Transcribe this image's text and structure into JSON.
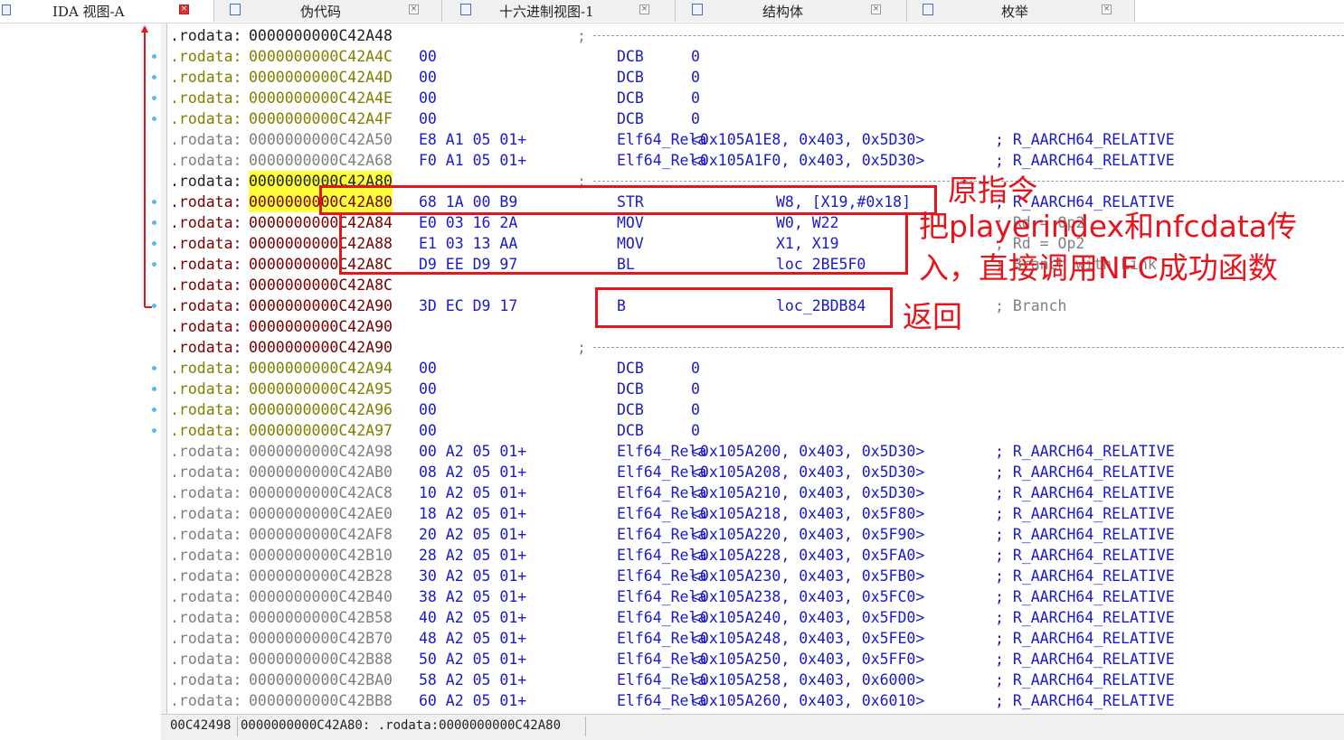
{
  "tabs": [
    {
      "label": "IDA 视图-A",
      "active": true,
      "icon": "ida-view-icon"
    },
    {
      "label": "伪代码",
      "active": false,
      "icon": "pseudocode-icon"
    },
    {
      "label": "十六进制视图-1",
      "active": false,
      "icon": "hex-view-icon"
    },
    {
      "label": "结构体",
      "active": false,
      "icon": "structures-icon"
    },
    {
      "label": "枚举",
      "active": false,
      "icon": "enums-icon"
    }
  ],
  "tab_close_glyph": "×",
  "listing": {
    "rows": [
      {
        "type": "sep",
        "seg": ".rodata:",
        "addr": "0000000000C42A48",
        "color": "black",
        "semi": ";"
      },
      {
        "type": "data",
        "seg": ".rodata:",
        "addr": "0000000000C42A4C",
        "color": "data",
        "bytes": "00",
        "mnem": "DCB",
        "op": "0"
      },
      {
        "type": "data",
        "seg": ".rodata:",
        "addr": "0000000000C42A4D",
        "color": "data",
        "bytes": "00",
        "mnem": "DCB",
        "op": "0"
      },
      {
        "type": "data",
        "seg": ".rodata:",
        "addr": "0000000000C42A4E",
        "color": "data",
        "bytes": "00",
        "mnem": "DCB",
        "op": "0"
      },
      {
        "type": "data",
        "seg": ".rodata:",
        "addr": "0000000000C42A4F",
        "color": "data",
        "bytes": "00",
        "mnem": "DCB",
        "op": "0"
      },
      {
        "type": "rela",
        "seg": ".rodata:",
        "addr": "0000000000C42A50",
        "color": "gray",
        "bytes": "E8 A1 05 01+",
        "mnem": "Elf64_Rela",
        "op": "<0x105A1E8, 0x403, 0x5D30>",
        "comment": "; R_AARCH64_RELATIVE"
      },
      {
        "type": "rela",
        "seg": ".rodata:",
        "addr": "0000000000C42A68",
        "color": "gray",
        "bytes": "F0 A1 05 01+",
        "mnem": "Elf64_Rela",
        "op": "<0x105A1F0, 0x403, 0x5D30>",
        "comment": "; R_AARCH64_RELATIVE"
      },
      {
        "type": "sep",
        "seg": ".rodata:",
        "addr": "0000000000C42A80",
        "color": "black",
        "highlight": true,
        "semi": ";"
      },
      {
        "type": "code",
        "seg": ".rodata:",
        "addr": "0000000000C42A80",
        "color": "code",
        "highlight": true,
        "bytes": "68 1A 00 B9",
        "mnem": "STR",
        "op": "W8, [X19,#0x18]",
        "comment": "; R_AARCH64_RELATIVE",
        "comment_color": "blue"
      },
      {
        "type": "code",
        "seg": ".rodata:",
        "addr": "0000000000C42A84",
        "color": "code",
        "bytes": "E0 03 16 2A",
        "mnem": "MOV",
        "op": "W0, W22",
        "comment": "; Rd = Op2",
        "comment_color": "comment"
      },
      {
        "type": "code",
        "seg": ".rodata:",
        "addr": "0000000000C42A88",
        "color": "code",
        "bytes": "E1 03 13 AA",
        "mnem": "MOV",
        "op": "X1, X19",
        "comment": "; Rd = Op2",
        "comment_color": "comment"
      },
      {
        "type": "code",
        "seg": ".rodata:",
        "addr": "0000000000C42A8C",
        "color": "code",
        "bytes": "D9 EE D9 97",
        "mnem": "BL",
        "op": "loc_2BE5F0",
        "comment": "; Branch with Link",
        "comment_color": "comment"
      },
      {
        "type": "plain",
        "seg": ".rodata:",
        "addr": "0000000000C42A8C",
        "color": "code"
      },
      {
        "type": "code",
        "seg": ".rodata:",
        "addr": "0000000000C42A90",
        "color": "code",
        "bytes": "3D EC D9 17",
        "mnem": "B",
        "op": "loc_2BDB84",
        "comment": "; Branch",
        "comment_color": "comment"
      },
      {
        "type": "plain",
        "seg": ".rodata:",
        "addr": "0000000000C42A90",
        "color": "code"
      },
      {
        "type": "sep",
        "seg": ".rodata:",
        "addr": "0000000000C42A90",
        "color": "code",
        "semi": ";"
      },
      {
        "type": "data",
        "seg": ".rodata:",
        "addr": "0000000000C42A94",
        "color": "data",
        "bytes": "00",
        "mnem": "DCB",
        "op": "0"
      },
      {
        "type": "data",
        "seg": ".rodata:",
        "addr": "0000000000C42A95",
        "color": "data",
        "bytes": "00",
        "mnem": "DCB",
        "op": "0"
      },
      {
        "type": "data",
        "seg": ".rodata:",
        "addr": "0000000000C42A96",
        "color": "data",
        "bytes": "00",
        "mnem": "DCB",
        "op": "0"
      },
      {
        "type": "data",
        "seg": ".rodata:",
        "addr": "0000000000C42A97",
        "color": "data",
        "bytes": "00",
        "mnem": "DCB",
        "op": "0"
      },
      {
        "type": "rela",
        "seg": ".rodata:",
        "addr": "0000000000C42A98",
        "color": "gray",
        "bytes": "00 A2 05 01+",
        "mnem": "Elf64_Rela",
        "op": "<0x105A200, 0x403, 0x5D30>",
        "comment": "; R_AARCH64_RELATIVE"
      },
      {
        "type": "rela",
        "seg": ".rodata:",
        "addr": "0000000000C42AB0",
        "color": "gray",
        "bytes": "08 A2 05 01+",
        "mnem": "Elf64_Rela",
        "op": "<0x105A208, 0x403, 0x5D30>",
        "comment": "; R_AARCH64_RELATIVE"
      },
      {
        "type": "rela",
        "seg": ".rodata:",
        "addr": "0000000000C42AC8",
        "color": "gray",
        "bytes": "10 A2 05 01+",
        "mnem": "Elf64_Rela",
        "op": "<0x105A210, 0x403, 0x5D30>",
        "comment": "; R_AARCH64_RELATIVE"
      },
      {
        "type": "rela",
        "seg": ".rodata:",
        "addr": "0000000000C42AE0",
        "color": "gray",
        "bytes": "18 A2 05 01+",
        "mnem": "Elf64_Rela",
        "op": "<0x105A218, 0x403, 0x5F80>",
        "comment": "; R_AARCH64_RELATIVE"
      },
      {
        "type": "rela",
        "seg": ".rodata:",
        "addr": "0000000000C42AF8",
        "color": "gray",
        "bytes": "20 A2 05 01+",
        "mnem": "Elf64_Rela",
        "op": "<0x105A220, 0x403, 0x5F90>",
        "comment": "; R_AARCH64_RELATIVE"
      },
      {
        "type": "rela",
        "seg": ".rodata:",
        "addr": "0000000000C42B10",
        "color": "gray",
        "bytes": "28 A2 05 01+",
        "mnem": "Elf64_Rela",
        "op": "<0x105A228, 0x403, 0x5FA0>",
        "comment": "; R_AARCH64_RELATIVE"
      },
      {
        "type": "rela",
        "seg": ".rodata:",
        "addr": "0000000000C42B28",
        "color": "gray",
        "bytes": "30 A2 05 01+",
        "mnem": "Elf64_Rela",
        "op": "<0x105A230, 0x403, 0x5FB0>",
        "comment": "; R_AARCH64_RELATIVE"
      },
      {
        "type": "rela",
        "seg": ".rodata:",
        "addr": "0000000000C42B40",
        "color": "gray",
        "bytes": "38 A2 05 01+",
        "mnem": "Elf64_Rela",
        "op": "<0x105A238, 0x403, 0x5FC0>",
        "comment": "; R_AARCH64_RELATIVE"
      },
      {
        "type": "rela",
        "seg": ".rodata:",
        "addr": "0000000000C42B58",
        "color": "gray",
        "bytes": "40 A2 05 01+",
        "mnem": "Elf64_Rela",
        "op": "<0x105A240, 0x403, 0x5FD0>",
        "comment": "; R_AARCH64_RELATIVE"
      },
      {
        "type": "rela",
        "seg": ".rodata:",
        "addr": "0000000000C42B70",
        "color": "gray",
        "bytes": "48 A2 05 01+",
        "mnem": "Elf64_Rela",
        "op": "<0x105A248, 0x403, 0x5FE0>",
        "comment": "; R_AARCH64_RELATIVE"
      },
      {
        "type": "rela",
        "seg": ".rodata:",
        "addr": "0000000000C42B88",
        "color": "gray",
        "bytes": "50 A2 05 01+",
        "mnem": "Elf64_Rela",
        "op": "<0x105A250, 0x403, 0x5FF0>",
        "comment": "; R_AARCH64_RELATIVE"
      },
      {
        "type": "rela",
        "seg": ".rodata:",
        "addr": "0000000000C42BA0",
        "color": "gray",
        "bytes": "58 A2 05 01+",
        "mnem": "Elf64_Rela",
        "op": "<0x105A258, 0x403, 0x6000>",
        "comment": "; R_AARCH64_RELATIVE"
      },
      {
        "type": "rela",
        "seg": ".rodata:",
        "addr": "0000000000C42BB8",
        "color": "gray",
        "bytes": "60 A2 05 01+",
        "mnem": "Elf64_Rela",
        "op": "<0x105A260, 0x403, 0x6010>",
        "comment": "; R_AARCH64_RELATIVE"
      }
    ]
  },
  "annotations": {
    "original_instruction": "原指令",
    "pass_args_line1": "把playerindex和nfcdata传",
    "pass_args_line2": "入，直接调用NFC成功函数",
    "return": "返回"
  },
  "statusbar": {
    "offset": "00C42498",
    "location": "0000000000C42A80: .rodata:0000000000C42A80"
  },
  "colors": {
    "annotation_red": "#e8141c",
    "instruction_blue": "#1a1acc",
    "code_address": "#7a0000",
    "data_address": "#808000",
    "rela_address": "#7f7f7f",
    "highlight_yellow": "#ffff3c",
    "breakpoint_dot": "#58b9f0"
  }
}
